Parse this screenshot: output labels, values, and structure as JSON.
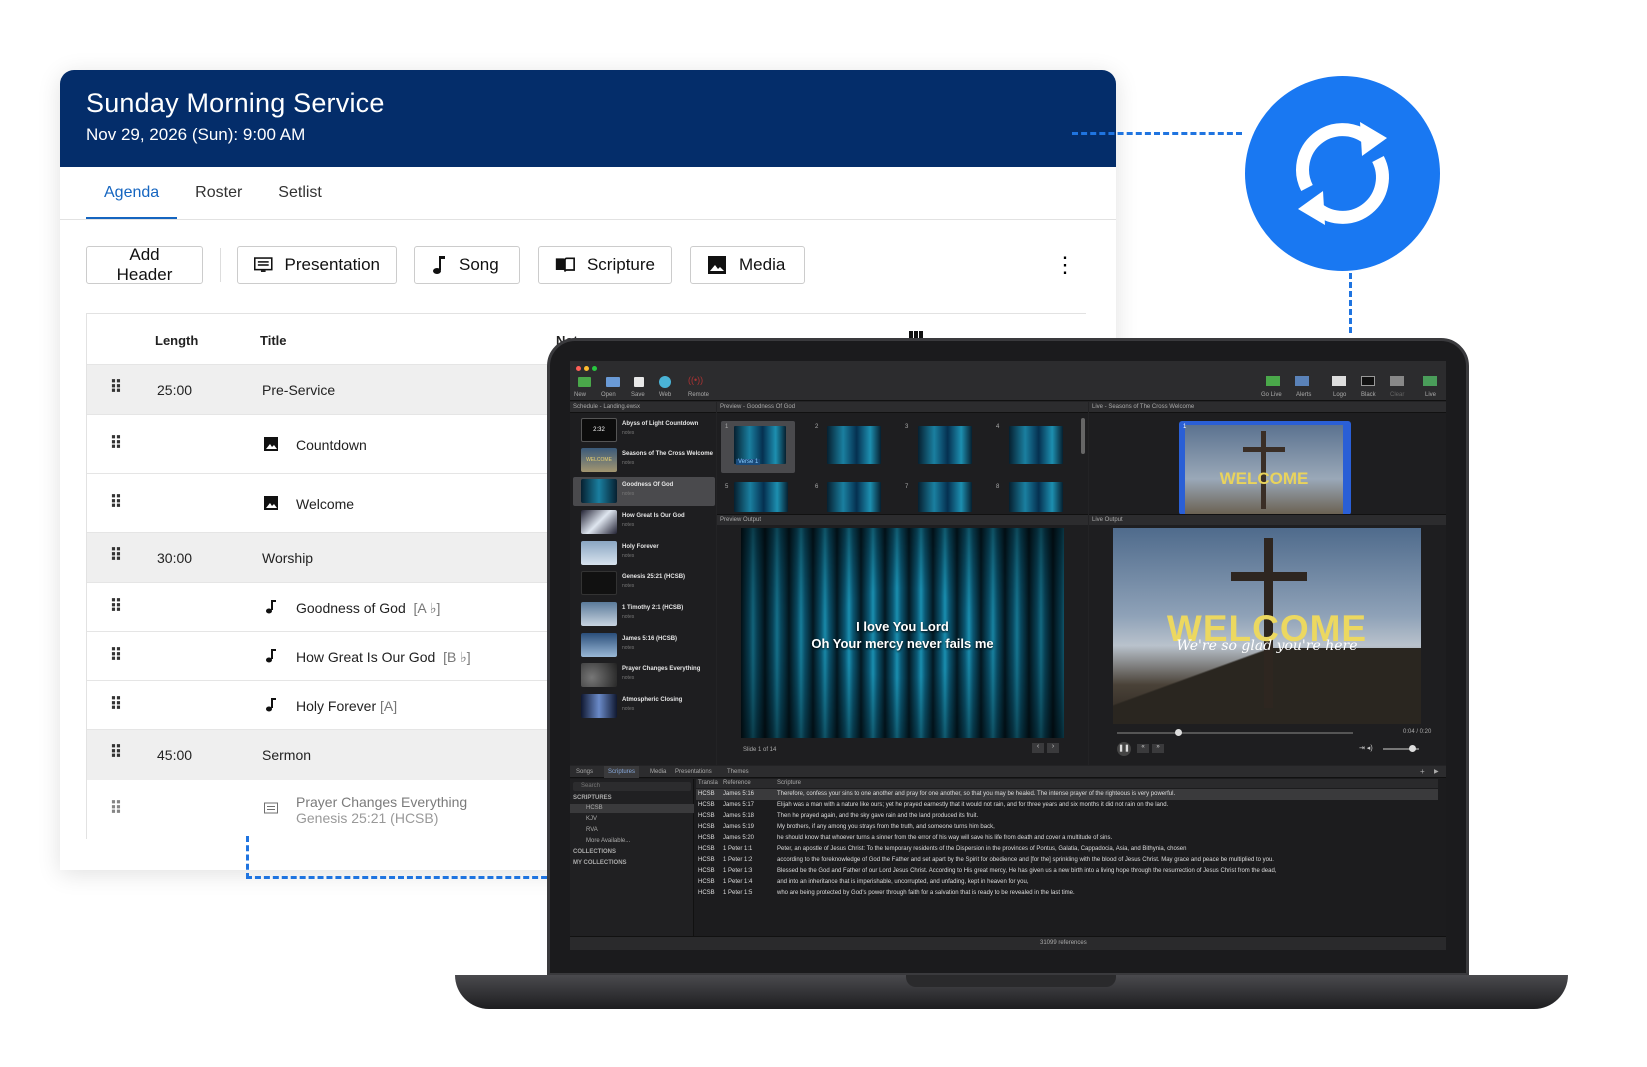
{
  "service": {
    "title": "Sunday Morning Service",
    "datetime": "Nov 29, 2026 (Sun): 9:00 AM",
    "tabs": [
      "Agenda",
      "Roster",
      "Setlist"
    ],
    "toolbar": {
      "add_header": "Add Header",
      "presentation": "Presentation",
      "song": "Song",
      "scripture": "Scripture",
      "media": "Media"
    },
    "table": {
      "headers": {
        "length": "Length",
        "title": "Title",
        "notes": "Notes"
      },
      "rows": [
        {
          "type": "header",
          "length": "25:00",
          "title": "Pre-Service"
        },
        {
          "type": "media",
          "title": "Countdown"
        },
        {
          "type": "media",
          "title": "Welcome"
        },
        {
          "type": "header",
          "length": "30:00",
          "title": "Worship"
        },
        {
          "type": "song",
          "title": "Goodness of God",
          "key": "[A ♭]"
        },
        {
          "type": "song",
          "title": "How Great Is Our God",
          "key": "[B ♭]"
        },
        {
          "type": "song",
          "title": "Holy Forever",
          "key": "[A]"
        },
        {
          "type": "header",
          "length": "45:00",
          "title": "Sermon"
        },
        {
          "type": "presentation",
          "title": "Prayer Changes Everything",
          "subtitle": "Genesis 25:21 (HCSB)"
        }
      ]
    }
  },
  "app": {
    "toolbar_left": [
      "New",
      "Open",
      "Save",
      "Web",
      "Remote"
    ],
    "toolbar_right": [
      "Go Live",
      "Alerts",
      "Logo",
      "Black",
      "Clear",
      "Live"
    ],
    "schedule_header": "Schedule - Landing.ewsx",
    "preview_header": "Preview - Goodness Of God",
    "live_header": "Live - Seasons of The Cross Welcome",
    "preview_output_label": "Preview Output",
    "live_output_label": "Live Output",
    "schedule_items": [
      {
        "name": "Abyss of Light Countdown",
        "notes": "notes",
        "thumb_text": "2:32"
      },
      {
        "name": "Seasons of The Cross Welcome",
        "notes": "notes",
        "thumb_text": "WELCOME"
      },
      {
        "name": "Goodness Of God",
        "notes": "notes"
      },
      {
        "name": "How Great Is Our God",
        "notes": "notes"
      },
      {
        "name": "Holy Forever",
        "notes": "notes"
      },
      {
        "name": "Genesis 25:21 (HCSB)",
        "notes": "notes"
      },
      {
        "name": "1 Timothy 2:1 (HCSB)",
        "notes": "notes"
      },
      {
        "name": "James 5:16 (HCSB)",
        "notes": "notes"
      },
      {
        "name": "Prayer Changes Everything",
        "notes": "notes"
      },
      {
        "name": "Atmospheric Closing",
        "notes": "notes"
      }
    ],
    "slide_numbers": [
      "1",
      "2",
      "3",
      "4",
      "5",
      "6",
      "7",
      "8"
    ],
    "slide1_label": "Verse 1",
    "lyrics_line1": "I love You Lord",
    "lyrics_line2": "Oh Your mercy never fails me",
    "slide_counter": "Slide 1 of 14",
    "welcome_title": "WELCOME",
    "welcome_script": "We're so glad you're here",
    "live_time": "0:04 / 0:20",
    "library_tabs": [
      "Songs",
      "Scriptures",
      "Media",
      "Presentations",
      "Themes"
    ],
    "search_placeholder": "Search",
    "scripture_tree": {
      "section": "SCRIPTURES",
      "items": [
        "HCSB",
        "KJV",
        "RVA"
      ],
      "more": "More Available...",
      "collections": "COLLECTIONS",
      "my_collections": "MY COLLECTIONS"
    },
    "ref_columns": {
      "translation": "Transla",
      "reference": "Reference",
      "scripture": "Scripture"
    },
    "references": [
      {
        "t": "HCSB",
        "r": "James 5:16",
        "s": "Therefore, confess your sins to one another and pray for one another, so that you may be healed. The intense prayer of the righteous is very powerful."
      },
      {
        "t": "HCSB",
        "r": "James 5:17",
        "s": "Elijah was a man with a nature like ours; yet he prayed earnestly that it would not rain, and for three years and six months it did not rain on the land."
      },
      {
        "t": "HCSB",
        "r": "James 5:18",
        "s": "Then he prayed again, and the sky gave rain and the land produced its fruit."
      },
      {
        "t": "HCSB",
        "r": "James 5:19",
        "s": "My brothers, if any among you strays from the truth, and someone turns him back,"
      },
      {
        "t": "HCSB",
        "r": "James 5:20",
        "s": "he should know that whoever turns a sinner from the error of his way will save his life from death and cover a multitude of sins."
      },
      {
        "t": "HCSB",
        "r": "1 Peter 1:1",
        "s": "Peter, an apostle of Jesus Christ: To the temporary residents of the Dispersion in the provinces of Pontus, Galatia, Cappadocia, Asia, and Bithynia, chosen"
      },
      {
        "t": "HCSB",
        "r": "1 Peter 1:2",
        "s": "according to the foreknowledge of God the Father and set apart by the Spirit for obedience and [for the] sprinkling with the blood of Jesus Christ. May grace and peace be multiplied to you."
      },
      {
        "t": "HCSB",
        "r": "1 Peter 1:3",
        "s": "Blessed be the God and Father of our Lord Jesus Christ. According to His great mercy, He has given us a new birth into a living hope through the resurrection of Jesus Christ from the dead,"
      },
      {
        "t": "HCSB",
        "r": "1 Peter 1:4",
        "s": "and into an inheritance that is imperishable, uncorrupted, and unfading, kept in heaven for you,"
      },
      {
        "t": "HCSB",
        "r": "1 Peter 1:5",
        "s": "who are being protected by God's power through faith for a salvation that is ready to be revealed in the last time."
      }
    ],
    "ref_count": "31099 references"
  },
  "colors": {
    "header_bg": "#042d6a",
    "accent": "#1565c0",
    "sync": "#1978f2"
  }
}
